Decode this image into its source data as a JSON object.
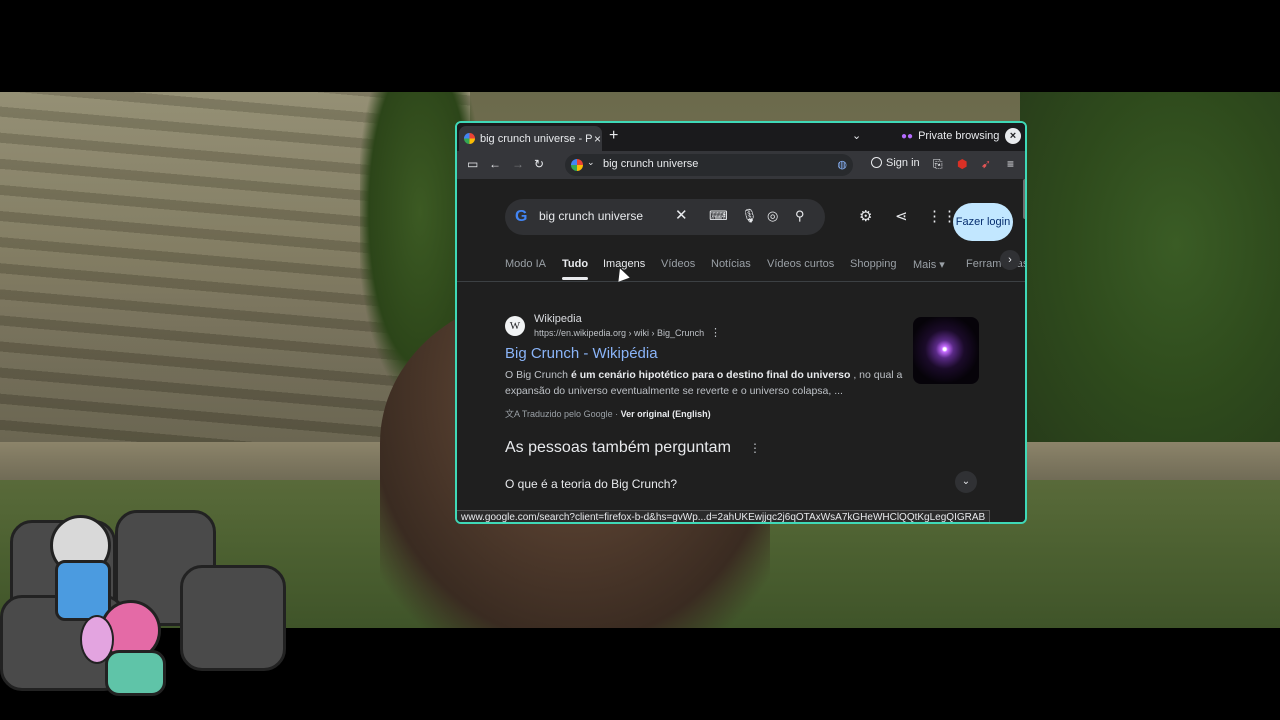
{
  "browser": {
    "tab_title": "big crunch universe - Pe",
    "tab_close": "×",
    "new_tab": "+",
    "private_label": "Private browsing",
    "window_close": "×"
  },
  "toolbar": {
    "url_text": "big crunch universe",
    "sign_in_label": "Sign in"
  },
  "search": {
    "query": "big crunch universe",
    "fazer_login": "Fazer login"
  },
  "nav_tabs": [
    "Modo IA",
    "Tudo",
    "Imagens",
    "Vídeos",
    "Notícias",
    "Vídeos curtos",
    "Shopping",
    "Mais",
    "Ferramentas"
  ],
  "result": {
    "site_name": "Wikipedia",
    "site_url": "https://en.wikipedia.org › wiki › Big_Crunch",
    "title": "Big Crunch - Wikipédia",
    "snippet_pre": "O Big Crunch ",
    "snippet_bold": "é um cenário hipotético para o destino final do universo",
    "snippet_post": " , no qual a expansão do universo eventualmente se reverte e o universo colapsa, ...",
    "translated_label": "Traduzido pelo Google · ",
    "original_link": "Ver original (English)"
  },
  "people_also_ask": {
    "heading": "As pessoas também perguntam",
    "question_1": "O que é a teoria do Big Crunch?"
  },
  "status_url": "www.google.com/search?client=firefox-b-d&hs=gvWp...d=2ahUKEwjjqc2j6qOTAxWsA7kGHeWHClQQtKgLegQIGRAB"
}
